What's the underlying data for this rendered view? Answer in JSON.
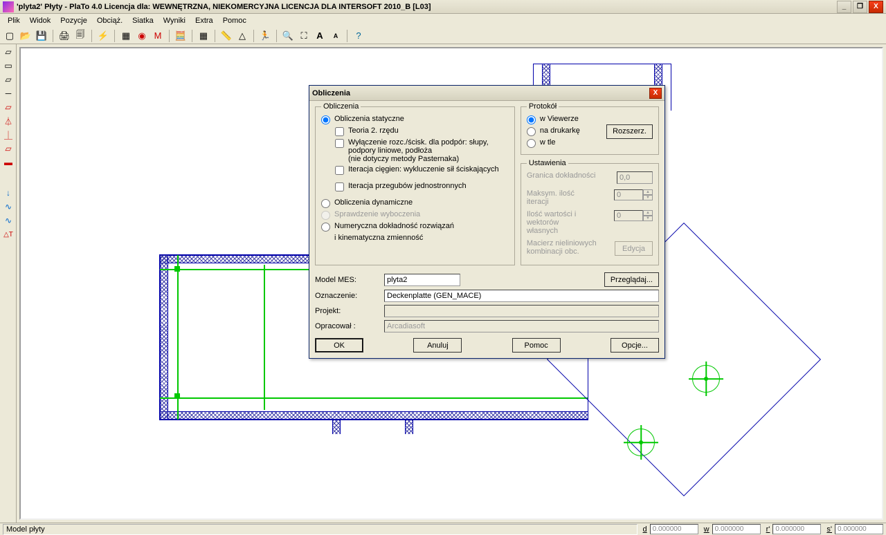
{
  "titlebar": {
    "text": "'plyta2' Płyty   - PlaTo 4.0  Licencja dla: WEWNĘTRZNA, NIEKOMERCYJNA LICENCJA DLA INTERSOFT 2010_B [L03]"
  },
  "menubar": {
    "items": [
      "Plik",
      "Widok",
      "Pozycje",
      "Obciąż.",
      "Siatka",
      "Wyniki",
      "Extra",
      "Pomoc"
    ]
  },
  "statusbar": {
    "left": "Model płyty",
    "coord": {
      "d": "0.000000",
      "w": "0.000000",
      "r": "0.000000",
      "s": "0.000000"
    }
  },
  "dialog": {
    "title": "Obliczenia",
    "group_calc": {
      "legend": "Obliczenia",
      "opt_static": "Obliczenia statyczne",
      "chk_theory": "Teoria 2. rzędu",
      "chk_wylacz": "Wyłączenie rozc./ścisk. dla podpór: słupy, podpory liniowe, podłoża\n(nie dotyczy metody Pasternaka)",
      "chk_iter_cieg": "Iteracja cięgien: wykluczenie sił ściskających",
      "chk_iter_przeg": "Iteracja przegubów jednostronnych",
      "opt_dynamic": "Obliczenia dynamiczne",
      "opt_stab": "Sprawdzenie wyboczenia",
      "opt_numeric": "Numeryczna dokładność rozwiązań",
      "kinematic": "i kinematyczna zmienność"
    },
    "group_proto": {
      "legend": "Protokół",
      "opt_viewer": "w Viewerze",
      "opt_print": "na drukarkę",
      "opt_bg": "w tle",
      "btn_ext": "Rozszerz."
    },
    "group_settings": {
      "legend": "Ustawienia",
      "lbl_granica": "Granica dokładności",
      "val_granica": "0,0",
      "lbl_maks": "Maksym. ilość iteracji",
      "val_maks": "0",
      "lbl_ilosc": "Ilość wartości i wektorów własnych",
      "val_ilosc": "0",
      "lbl_macierz": "Macierz nieliniowych kombinacji obc.",
      "btn_edycja": "Edycja"
    },
    "form": {
      "lbl_model": "Model MES:",
      "val_model": "plyta2",
      "btn_browse": "Przeglądaj...",
      "lbl_ozn": "Oznaczenie:",
      "val_ozn": "Deckenplatte (GEN_MACE)",
      "lbl_projekt": "Projekt:",
      "val_projekt": "",
      "lbl_oprac": "Opracował :",
      "val_oprac": "Arcadiasoft"
    },
    "buttons": {
      "ok": "OK",
      "cancel": "Anuluj",
      "help": "Pomoc",
      "opts": "Opcje..."
    }
  }
}
